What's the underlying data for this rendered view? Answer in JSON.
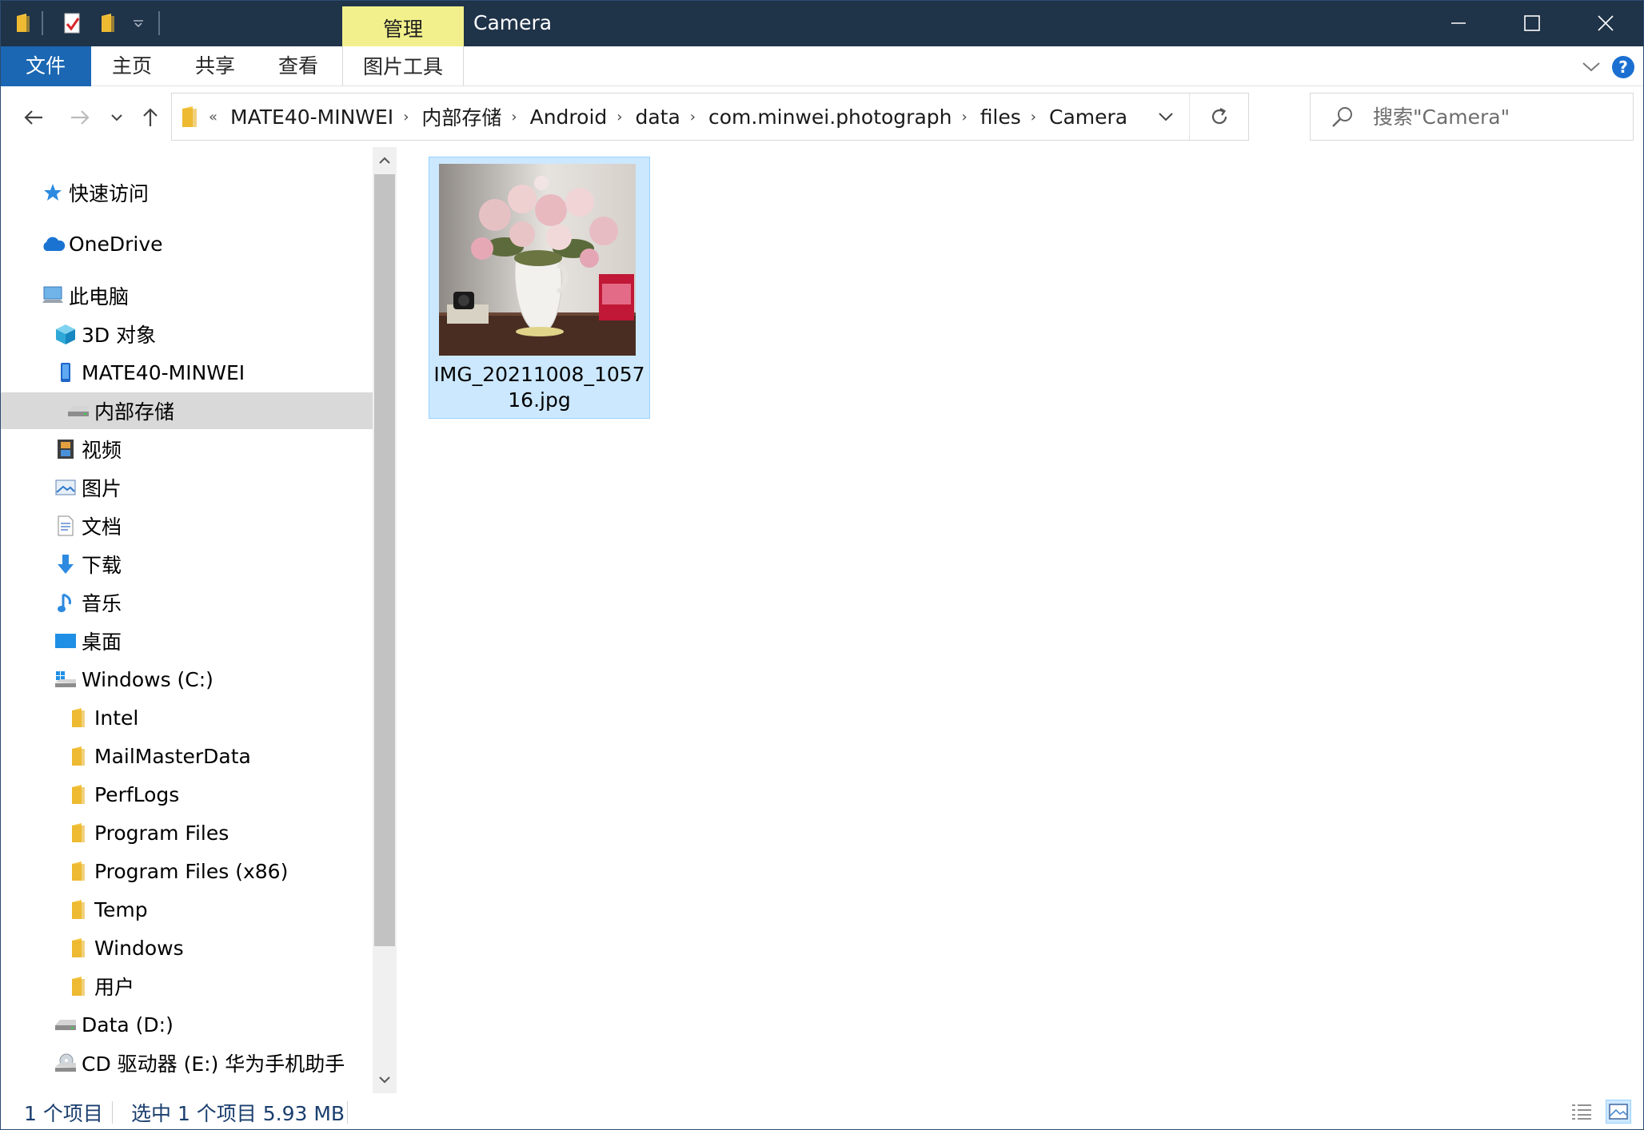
{
  "titlebar": {
    "manage_tab": "管理",
    "title": "Camera"
  },
  "ribbon": {
    "file": "文件",
    "home": "主页",
    "share": "共享",
    "view": "查看",
    "picture_tools": "图片工具",
    "help": "?"
  },
  "address": {
    "more": "«",
    "crumbs": [
      "MATE40-MINWEI",
      "内部存储",
      "Android",
      "data",
      "com.minwei.photograph",
      "files",
      "Camera"
    ],
    "separator": "›"
  },
  "search": {
    "placeholder": "搜索\"Camera\""
  },
  "nav": {
    "items": [
      {
        "label": "快速访问",
        "icon": "star-icon"
      },
      {
        "label": "OneDrive",
        "icon": "cloud-icon"
      },
      {
        "label": "此电脑",
        "icon": "computer-icon"
      },
      {
        "label": "3D 对象",
        "icon": "cube-icon"
      },
      {
        "label": "MATE40-MINWEI",
        "icon": "phone-icon"
      },
      {
        "label": "内部存储",
        "icon": "drive-icon",
        "selected": true
      },
      {
        "label": "视频",
        "icon": "film-icon"
      },
      {
        "label": "图片",
        "icon": "picture-icon"
      },
      {
        "label": "文档",
        "icon": "document-icon"
      },
      {
        "label": "下载",
        "icon": "download-icon"
      },
      {
        "label": "音乐",
        "icon": "music-icon"
      },
      {
        "label": "桌面",
        "icon": "desktop-icon"
      },
      {
        "label": "Windows (C:)",
        "icon": "windows-drive-icon"
      },
      {
        "label": "Intel",
        "icon": "folder-icon"
      },
      {
        "label": "MailMasterData",
        "icon": "folder-icon"
      },
      {
        "label": "PerfLogs",
        "icon": "folder-icon"
      },
      {
        "label": "Program Files",
        "icon": "folder-icon"
      },
      {
        "label": "Program Files (x86)",
        "icon": "folder-icon"
      },
      {
        "label": "Temp",
        "icon": "folder-icon"
      },
      {
        "label": "Windows",
        "icon": "folder-icon"
      },
      {
        "label": "用户",
        "icon": "folder-icon"
      },
      {
        "label": "Data (D:)",
        "icon": "drive-icon"
      },
      {
        "label": "CD 驱动器 (E:) 华为手机助手",
        "icon": "cd-drive-icon"
      }
    ]
  },
  "files": [
    {
      "name_line1": "IMG_20211008_1057",
      "name_line2": "16.jpg",
      "selected": true
    }
  ],
  "status": {
    "count": "1 个项目",
    "selection": "选中 1 个项目  5.93 MB"
  },
  "colors": {
    "titlebar": "#1f3349",
    "file_tab": "#1b67b3",
    "manage_tab": "#f2f08c",
    "selection": "#cce8ff",
    "nav_selected": "#d9d9d9"
  }
}
